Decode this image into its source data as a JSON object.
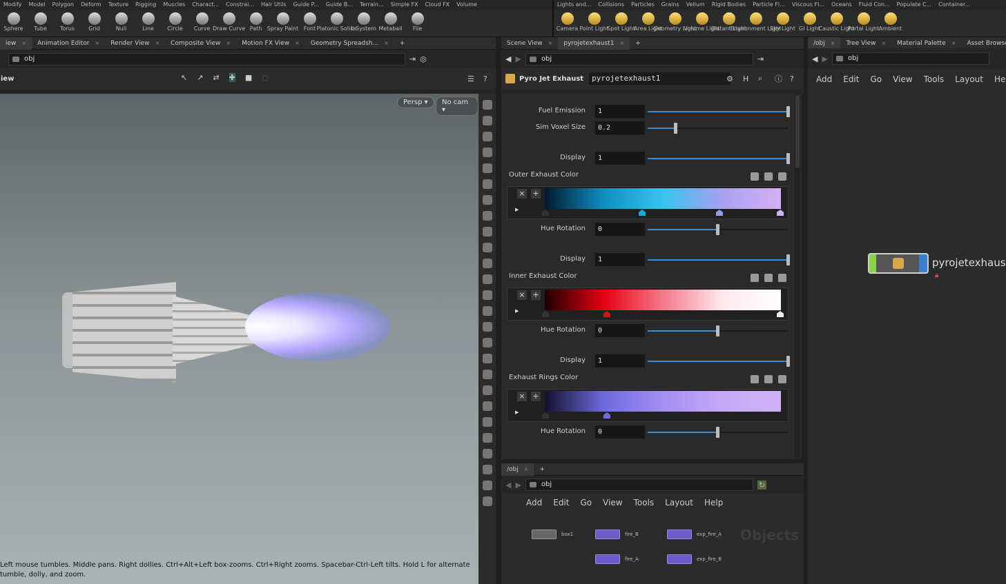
{
  "shelf": {
    "tabs_left": [
      "Modify",
      "Model",
      "Polygon",
      "Deform",
      "Texture",
      "Rigging",
      "Muscles",
      "Charact...",
      "Constrai...",
      "Hair Utils",
      "Guide P...",
      "Guide B...",
      "Terrain...",
      "Simple FX",
      "Cloud FX",
      "Volume"
    ],
    "tabs_right": [
      "Lights and...",
      "Collisions",
      "Particles",
      "Grains",
      "Vellum",
      "Rigid Bodies",
      "Particle Fl...",
      "Viscous Fl...",
      "Oceans",
      "Fluid Con...",
      "Populate C...",
      "Container..."
    ],
    "tools_left": [
      "Sphere",
      "Tube",
      "Torus",
      "Grid",
      "Null",
      "Line",
      "Circle",
      "Curve",
      "Draw Curve",
      "Path",
      "Spray Paint",
      "Font",
      "Platonic Solids",
      "L-System",
      "Metaball",
      "File"
    ],
    "tools_right": [
      "Camera",
      "Point Light",
      "Spot Light",
      "Area Light",
      "Geometry Light",
      "Volume Light",
      "Distant Light",
      "Environment Light",
      "Sky Light",
      "GI Light",
      "Caustic Light",
      "Portal Light",
      "Ambient"
    ]
  },
  "left_tabs": [
    "iew",
    "Animation Editor",
    "Render View",
    "Composite View",
    "Motion FX View",
    "Geometry Spreadsh..."
  ],
  "left_path": "obj",
  "viewport": {
    "title": "iew",
    "persp": "Persp",
    "cam": "No cam"
  },
  "status_text": "Left mouse tumbles. Middle pans. Right dollies. Ctrl+Alt+Left box-zooms. Ctrl+Right zooms. Spacebar-Ctrl-Left tilts. Hold L for alternate tumble, dolly, and zoom.",
  "center_tabs": [
    "Scene View",
    "pyrojetexhaust1"
  ],
  "center_path": "obj",
  "params": {
    "node_type": "Pyro Jet Exhaust",
    "node_name": "pyrojetexhaust1",
    "fuel_emission": {
      "label": "Fuel Emission",
      "value": "1",
      "level": 1.0
    },
    "sim_voxel_size": {
      "label": "Sim Voxel Size",
      "value": "0.2",
      "level": 0.2
    },
    "display1": {
      "label": "Display",
      "value": "1",
      "level": 1.0
    },
    "outer_color": {
      "label": "Outer Exhaust Color",
      "colors": [
        "#001a2e",
        "#0f8fc2",
        "#38c3ef",
        "#a8a0ef",
        "#d6b0f5"
      ]
    },
    "hue1": {
      "label": "Hue Rotation",
      "value": "0",
      "level": 0.5
    },
    "display2": {
      "label": "Display",
      "value": "1",
      "level": 1.0
    },
    "inner_color": {
      "label": "Inner Exhaust Color",
      "colors": [
        "#1c0000",
        "#e60012",
        "#f47a8a",
        "#ffe8ee",
        "#ffffff"
      ]
    },
    "hue2": {
      "label": "Hue Rotation",
      "value": "0",
      "level": 0.5
    },
    "display3": {
      "label": "Display",
      "value": "1",
      "level": 1.0
    },
    "rings_color": {
      "label": "Exhaust Rings Color",
      "colors": [
        "#14102e",
        "#6e6ae0",
        "#a38ef2",
        "#c6a8f7",
        "#cfb2f8"
      ]
    },
    "hue3": {
      "label": "Hue Rotation",
      "value": "0",
      "level": 0.5
    }
  },
  "right_tabs": [
    "/obj",
    "Tree View",
    "Material Palette",
    "Asset Browser"
  ],
  "right_path": "obj",
  "net_menu": [
    "Add",
    "Edit",
    "Go",
    "View",
    "Tools",
    "Layout",
    "Help"
  ],
  "net_node": "pyrojetexhaus",
  "bottom_tabs": [
    "/obj"
  ],
  "bottom_path": "obj",
  "bottom_menu": [
    "Add",
    "Edit",
    "Go",
    "View",
    "Tools",
    "Layout",
    "Help"
  ],
  "bottom_label": "Objects",
  "bottom_nodes": [
    "box1",
    "fire_B",
    "exp_fire_A",
    "fire_A",
    "exp_fire_B"
  ]
}
